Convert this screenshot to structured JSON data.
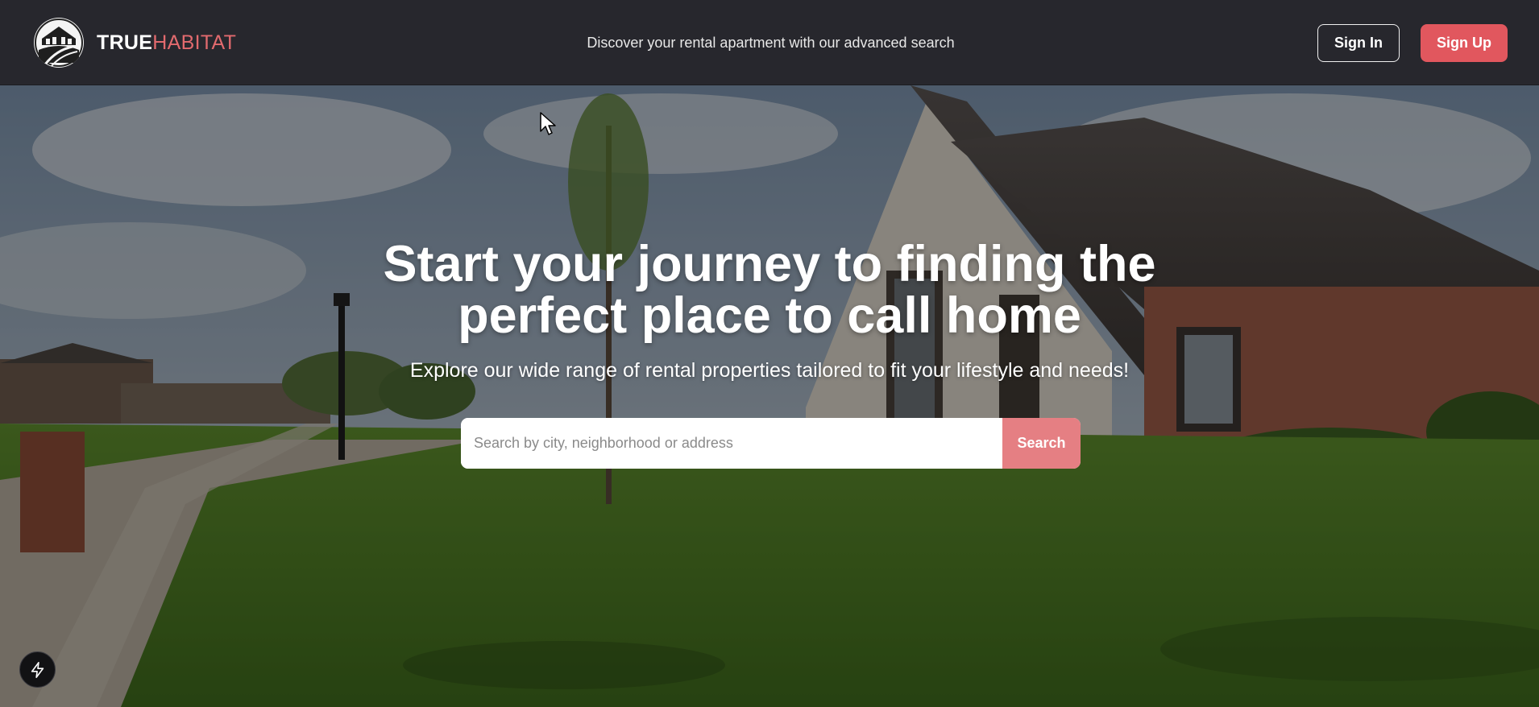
{
  "header": {
    "brand_bold": "TRUE",
    "brand_light": "HABITAT",
    "tagline": "Discover your rental apartment with our advanced search",
    "sign_in_label": "Sign In",
    "sign_up_label": "Sign Up"
  },
  "hero": {
    "headline_line1": "Start your journey to finding the",
    "headline_line2": "perfect place to call home",
    "subheadline": "Explore our wide range of rental properties tailored to fit your lifestyle and needs!",
    "search": {
      "placeholder": "Search by city, neighborhood or address",
      "value": "",
      "button_label": "Search"
    }
  },
  "icons": {
    "logo": "house-logo-icon",
    "dev_tools": "lightning-bolt-icon",
    "cursor": "mouse-pointer-icon"
  },
  "colors": {
    "nav_bg": "#27272d",
    "accent": "#e1575e",
    "search_button": "#e57f83",
    "brand_habitat": "#e26a6e"
  }
}
